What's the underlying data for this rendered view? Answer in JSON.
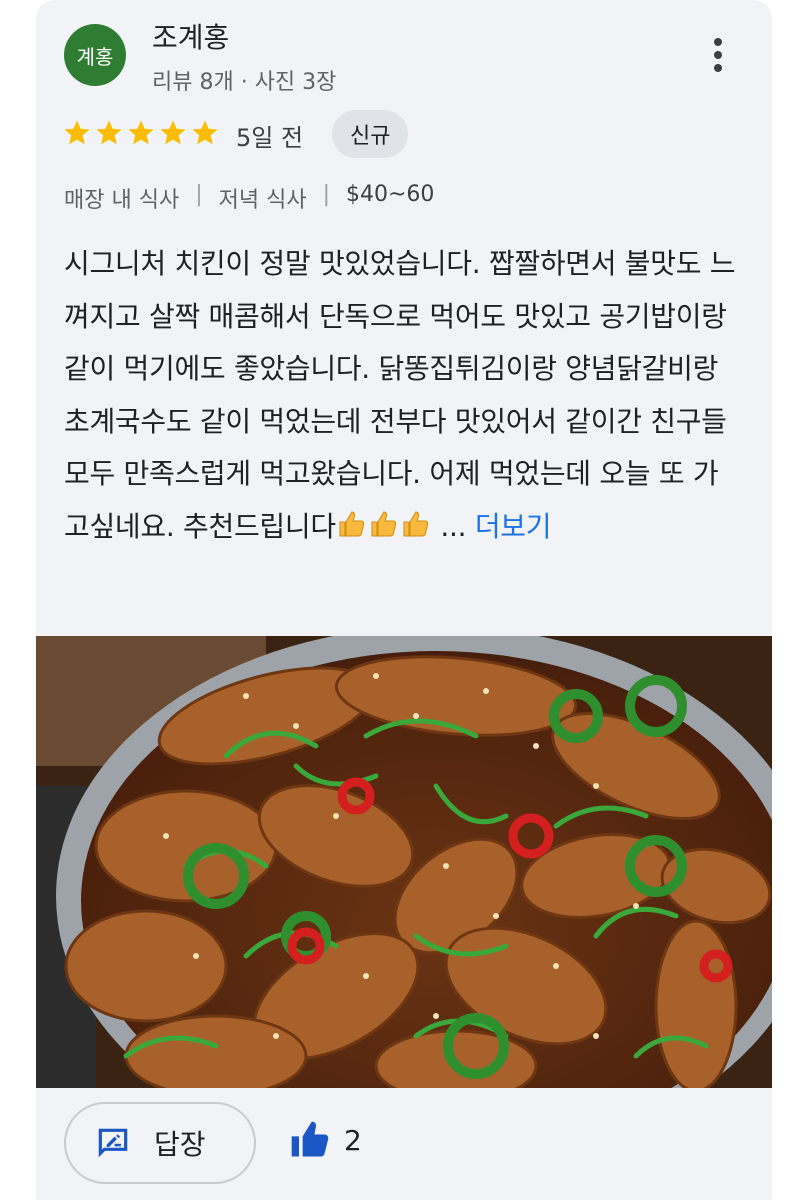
{
  "reviewer": {
    "avatar_text": "계홍",
    "avatar_color": "#2e7d32",
    "name": "조계홍",
    "meta": "리뷰 8개 · 사진 3장"
  },
  "rating": {
    "stars": 5,
    "max": 5,
    "age": "5일 전",
    "badge": "신규"
  },
  "details": {
    "dining": "매장 내 식사",
    "meal": "저녁 식사",
    "price": "$40~60",
    "separator": "|"
  },
  "review": {
    "text": "시그니처 치킨이 정말 맛있었습니다. 짭짤하면서 불맛도 느껴지고 살짝 매콤해서 단독으로 먹어도 맛있고 공기밥이랑 같이 먹기에도 좋았습니다. 닭똥집튀김이랑 양념닭갈비랑 초계국수도 같이 먹었는데 전부다 맛있어서 같이간 친구들 모두 만족스럽게 먹고왔습니다. 어제 먹었는데 오늘 또 가고싶네요. 추천드립니다",
    "ellipsis": "...",
    "more_label": "더보기"
  },
  "photo": {
    "icon": "food-photo",
    "subject": "spicy glazed chicken with scallions and peppers"
  },
  "actions": {
    "reply_label": "답장",
    "like_count": "2"
  },
  "colors": {
    "accent": "#1a73e8",
    "star": "#fbbc04",
    "card_bg": "#f1f3f6"
  }
}
